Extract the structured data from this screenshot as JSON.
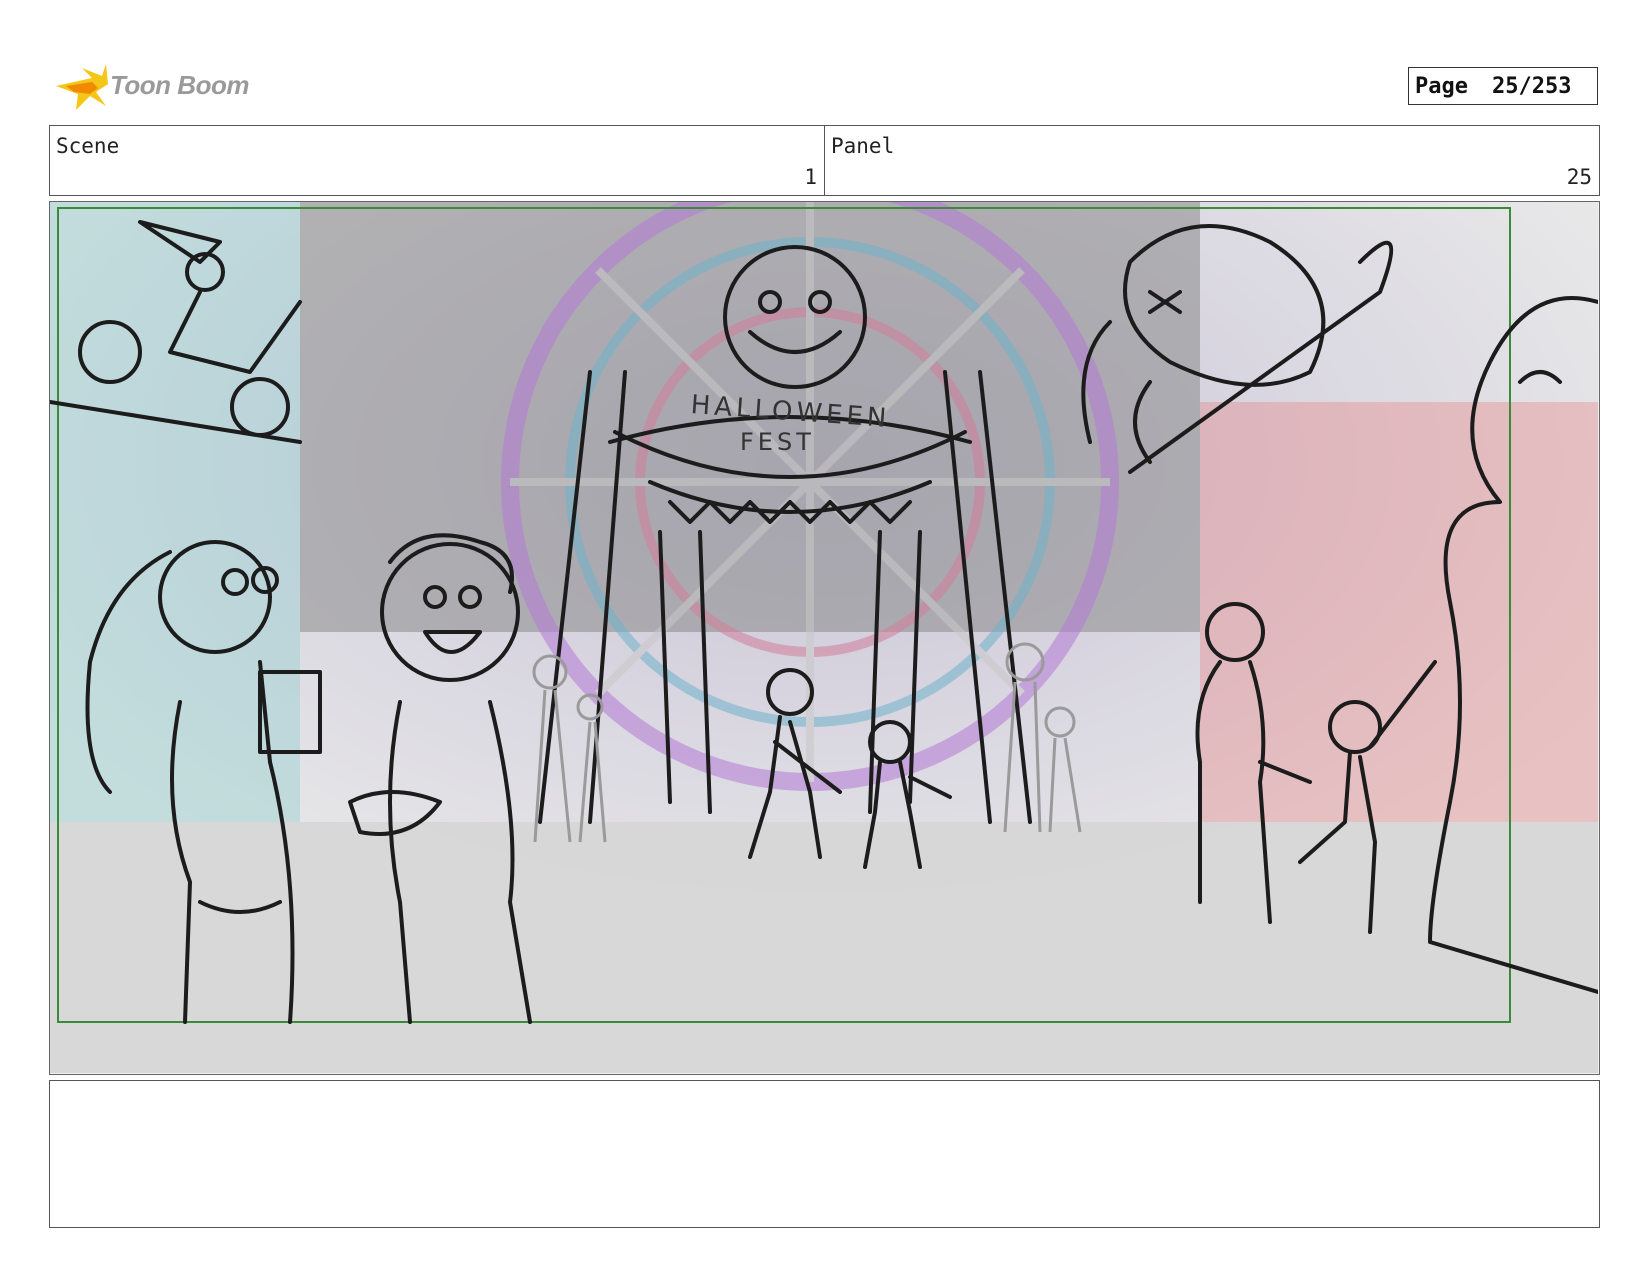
{
  "header": {
    "logo_text": "Toon Boom",
    "page_label": "Page",
    "page_value": "25/253"
  },
  "info": {
    "scene_label": "Scene",
    "scene_value": "1",
    "panel_label": "Panel",
    "panel_value": "25"
  },
  "panel": {
    "sign_line1": "HALLOWEEN",
    "sign_line2": "FEST"
  },
  "notes": {
    "text": ""
  },
  "colors": {
    "safe_area": "#3a8a3a",
    "logo_yellow": "#f5c518",
    "logo_orange": "#f08a00",
    "logo_text": "#9a9a9a",
    "sketch_line": "#1c1c1c"
  }
}
